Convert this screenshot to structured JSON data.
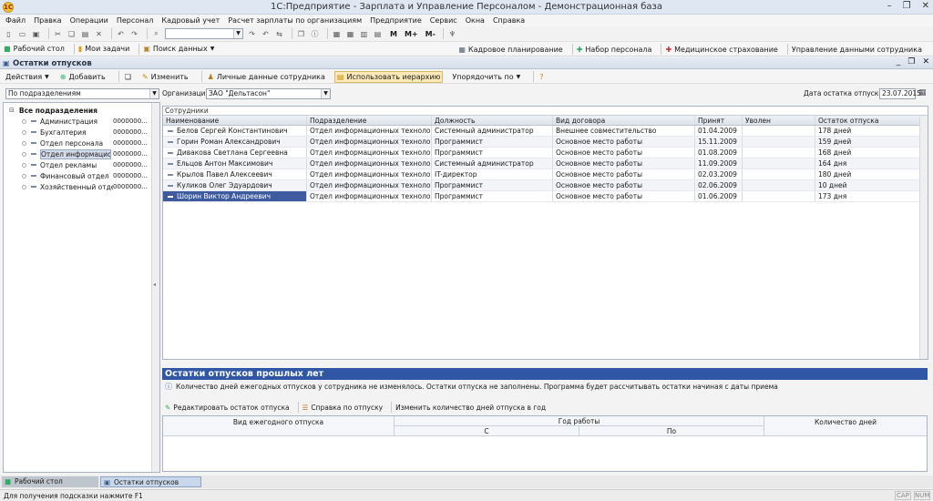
{
  "window": {
    "title": "1С:Предприятие - Зарплата и Управление Персоналом - Демонстрационная база"
  },
  "menu": [
    "Файл",
    "Правка",
    "Операции",
    "Персонал",
    "Кадровый учет",
    "Расчет зарплаты по организациям",
    "Предприятие",
    "Сервис",
    "Окна",
    "Справка"
  ],
  "toolbar1": {
    "m_labels": [
      "M",
      "M+",
      "M-"
    ]
  },
  "toolbar2": {
    "left": [
      "Рабочий стол",
      "Мои задачи",
      "Поиск данных"
    ],
    "right": [
      "Кадровое планирование",
      "Набор персонала",
      "Медицинское страхование",
      "Управление данными сотрудника"
    ]
  },
  "doc": {
    "title": "Остатки отпусков"
  },
  "actions": {
    "actions_label": "Действия",
    "add": "Добавить",
    "edit": "Изменить",
    "personal": "Личные данные сотрудника",
    "hierarchy": "Использовать иерархию",
    "sort": "Упорядочить по"
  },
  "filter": {
    "by": "По подразделениям",
    "org_label": "Организация:",
    "org_value": "ЗАО \"Дельтасон\"",
    "date_label": "Дата остатка отпусков:",
    "date_value": "23.07.2015"
  },
  "tree": {
    "root": "Все подразделения",
    "items": [
      {
        "name": "Администрация",
        "code": "0000000..."
      },
      {
        "name": "Бухгалтерия",
        "code": "0000000..."
      },
      {
        "name": "Отдел персонала",
        "code": "0000000..."
      },
      {
        "name": "Отдел информацион...",
        "code": "0000000..."
      },
      {
        "name": "Отдел рекламы",
        "code": "0000000..."
      },
      {
        "name": "Финансовый отдел",
        "code": "0000000..."
      },
      {
        "name": "Хозяйственный отдел",
        "code": "0000000..."
      }
    ]
  },
  "employees": {
    "title": "Сотрудники",
    "columns": [
      "Наименование",
      "Подразделение",
      "Должность",
      "Вид договора",
      "Принят",
      "Уволен",
      "Остаток отпуска"
    ],
    "rows": [
      [
        "Белов Сергей Константинович",
        "Отдел информационных технологий",
        "Системный администратор",
        "Внешнее совместительство",
        "01.04.2009",
        "",
        "178 дней"
      ],
      [
        "Горин Роман Александрович",
        "Отдел информационных технологий",
        "Программист",
        "Основное место работы",
        "15.11.2009",
        "",
        "159 дней"
      ],
      [
        "Дивакова Светлана Сергеевна",
        "Отдел информационных технологий",
        "Программист",
        "Основное место работы",
        "01.08.2009",
        "",
        "168 дней"
      ],
      [
        "Ельцов Антон Максимович",
        "Отдел информационных технологий",
        "Системный администратор",
        "Основное место работы",
        "11.09.2009",
        "",
        "164 дня"
      ],
      [
        "Крылов Павел Алексеевич",
        "Отдел информационных технологий",
        "IT-директор",
        "Основное место работы",
        "02.03.2009",
        "",
        "180 дней"
      ],
      [
        "Куликов Олег Эдуардович",
        "Отдел информационных технологий",
        "Программист",
        "Основное место работы",
        "02.06.2009",
        "",
        "10 дней"
      ],
      [
        "Шорин Виктор Андреевич",
        "Отдел информационных технологий",
        "Программист",
        "Основное место работы",
        "01.06.2009",
        "",
        "173 дня"
      ]
    ]
  },
  "past": {
    "title": "Остатки отпусков прошлых лет",
    "info": "Количество дней ежегодных отпусков у сотрудника не изменялось. Остатки отпуска не заполнены. Программа будет рассчитывать остатки начиная с даты приема",
    "edit": "Редактировать остаток отпуска",
    "help": "Справка по отпуску",
    "change": "Изменить количество дней отпуска в год",
    "col_type": "Вид ежегодного отпуска",
    "col_year": "Год работы",
    "col_from": "С",
    "col_to": "По",
    "col_days": "Количество дней"
  },
  "tabs": [
    "Рабочий стол",
    "Остатки отпусков"
  ],
  "status": {
    "hint": "Для получения подсказки нажмите F1",
    "cap": "CAP",
    "num": "NUM"
  },
  "colors": {
    "accent": "#2f57a6",
    "selected": "#3d5b9e"
  }
}
